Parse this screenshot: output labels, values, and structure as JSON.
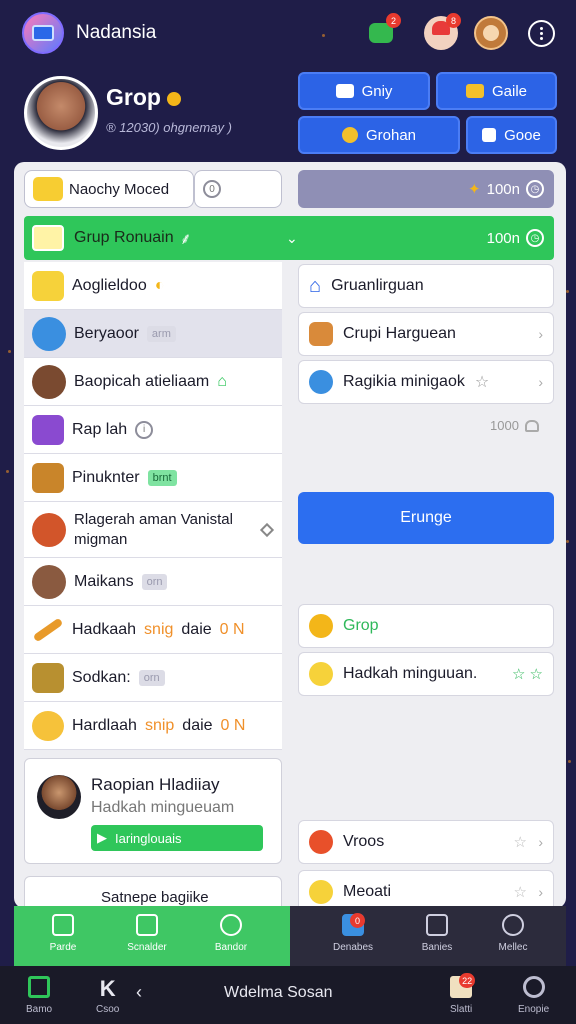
{
  "app": {
    "name": "Nadansia",
    "notif_badge_1": "2",
    "notif_badge_2": "8"
  },
  "profile": {
    "name": "Grop",
    "subtitle": "® 12030) ohgnemay )"
  },
  "profile_buttons": [
    "Gniy",
    "Gaile",
    "Grohan",
    "Gooe"
  ],
  "toolbar": {
    "search_label": "Naochy Moced",
    "stat_value": "100n",
    "stat_icon_char": "0"
  },
  "highlight_row": {
    "label": "Grup Ronuain",
    "value": "100n"
  },
  "left_list": [
    {
      "label": "Aoglieldoo",
      "tag": ""
    },
    {
      "label": "Beryaoor",
      "tag": "arm"
    },
    {
      "label": "Baopicah atieliaam",
      "tag": ""
    },
    {
      "label": "Rap lah",
      "tag": ""
    },
    {
      "label": "Pinuknter",
      "tag": "brnt"
    },
    {
      "label": "Rlagerah aman Vanistal migman",
      "tag": ""
    },
    {
      "label": "Maikans",
      "tag": "orn"
    },
    {
      "label": "Hadkaah",
      "orange": "snig",
      "suffix": "daie",
      "num": "0 N"
    },
    {
      "label": "Sodkan:",
      "tag": "orn"
    },
    {
      "label": "Hardlaah",
      "orange": "snip",
      "suffix": "daie",
      "num": "0 N"
    }
  ],
  "profile_card": {
    "name": "Raopian Hladiiay",
    "subtitle": "Hadkah mingueuam",
    "action": "Iaringlouais"
  },
  "bottom_card": {
    "label": "Satnepe bagiike"
  },
  "right_list": [
    {
      "label": "Gruanlirguan"
    },
    {
      "label": "Crupi Harguean"
    },
    {
      "label": "Ragikia minigaok"
    }
  ],
  "likes": {
    "count": "1000"
  },
  "primary_button": {
    "label": "Erunge"
  },
  "right_list_2": [
    {
      "label": "Grop"
    },
    {
      "label": "Hadkah minguuan."
    },
    {
      "label": "Vroos"
    },
    {
      "label": "Meoati"
    }
  ],
  "tabs": [
    "Parde",
    "Scnalder",
    "Bandor",
    "Denabes",
    "Banies",
    "Mellec"
  ],
  "tab_badge": "0",
  "system_bar": {
    "title": "Wdelma Sosan",
    "items": [
      "Bamo",
      "Csoo",
      "Slatti",
      "Enopie"
    ],
    "badge": "22"
  },
  "colors": {
    "accent_green": "#2fc65a",
    "accent_blue": "#2c63e6",
    "background": "#1f1d48"
  }
}
